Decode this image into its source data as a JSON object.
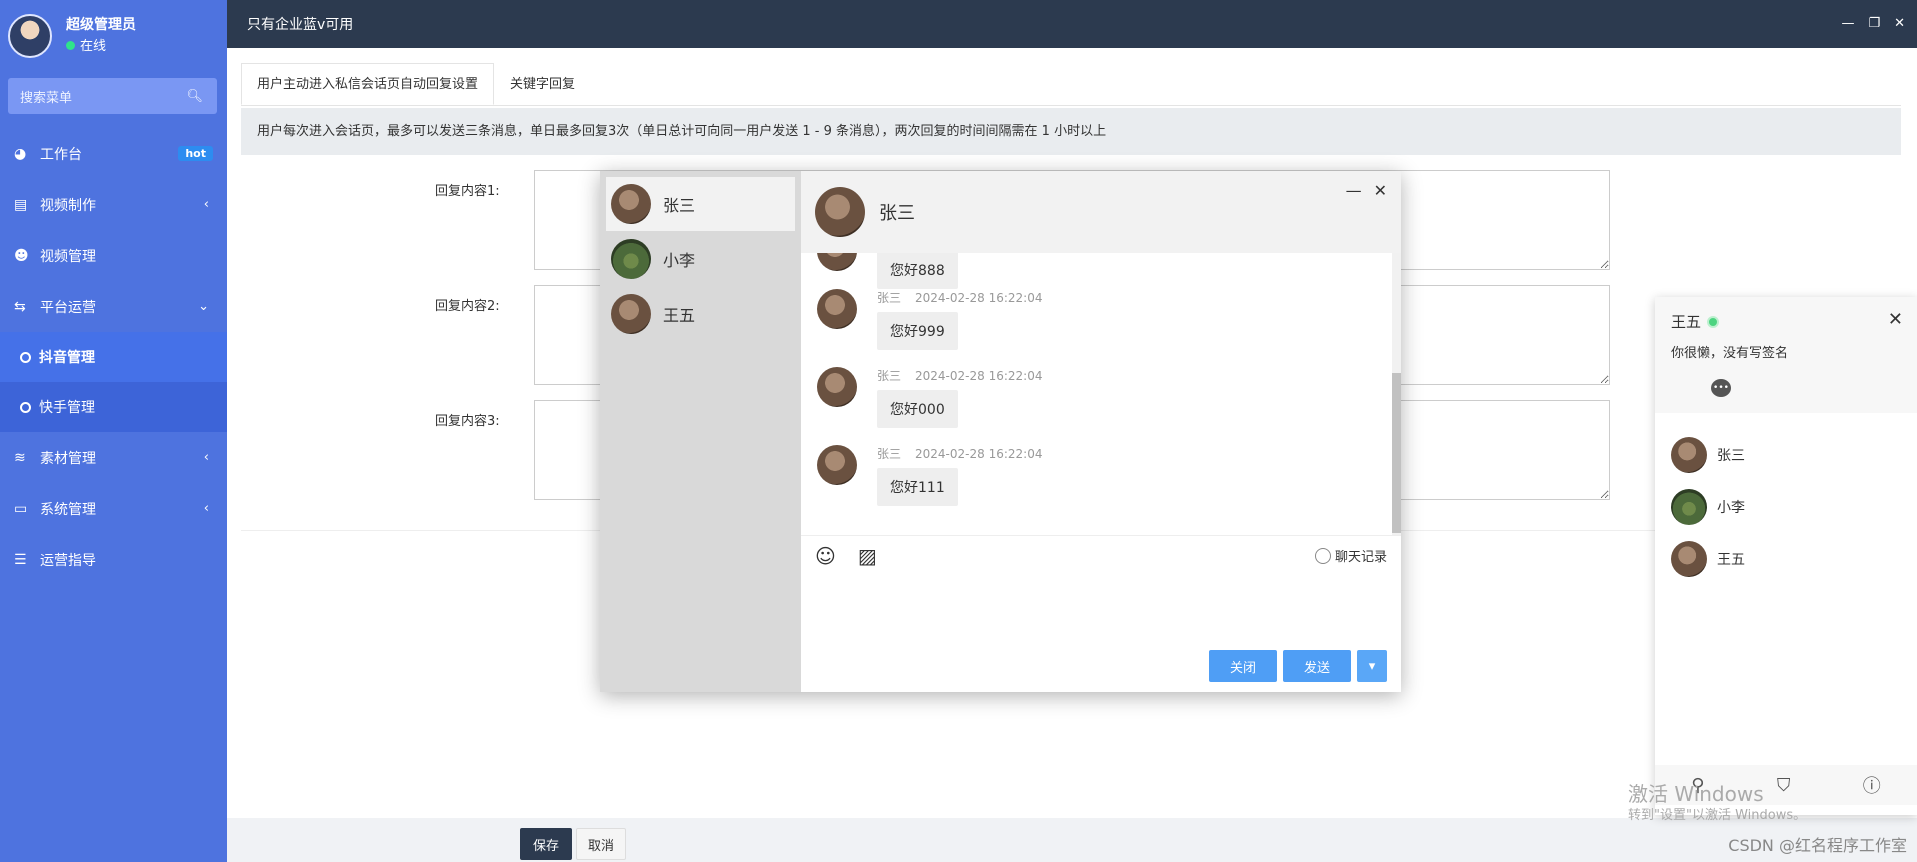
{
  "user": {
    "name": "超级管理员",
    "status": "在线"
  },
  "search": {
    "placeholder": "搜索菜单"
  },
  "menu": {
    "workbench": "工作台",
    "hot": "hot",
    "video_make": "视频制作",
    "video_manage": "视频管理",
    "platform": "平台运营",
    "douyin": "抖音管理",
    "kuaishou": "快手管理",
    "material": "素材管理",
    "system": "系统管理",
    "guide": "运营指导"
  },
  "window": {
    "title": "只有企业蓝v可用"
  },
  "tabs": [
    "用户主动进入私信会话页自动回复设置",
    "关键字回复"
  ],
  "notice": "用户每次进入会话页，最多可以发送三条消息，单日最多回复3次（单日总计可向同一用户发送 1 - 9 条消息），两次回复的时间间隔需在 1 小时以上",
  "form": {
    "label1": "回复内容1:",
    "label2": "回复内容2:",
    "label3": "回复内容3:"
  },
  "footer": {
    "save": "保存",
    "cancel": "取消"
  },
  "chat": {
    "list": [
      "张三",
      "小李",
      "王五"
    ],
    "header_name": "张三",
    "messages": [
      {
        "text": "您好888"
      },
      {
        "name": "张三",
        "time": "2024-02-28 16:22:04",
        "text": "您好999"
      },
      {
        "name": "张三",
        "time": "2024-02-28 16:22:04",
        "text": "您好000"
      },
      {
        "name": "张三",
        "time": "2024-02-28 16:22:04",
        "text": "您好111"
      }
    ],
    "history": "聊天记录",
    "close": "关闭",
    "send": "发送"
  },
  "contacts": {
    "name": "王五",
    "sign": "你很懒，没有写签名",
    "list": [
      "张三",
      "小李",
      "王五"
    ]
  },
  "watermark": {
    "line1": "激活 Windows",
    "line2": "转到\"设置\"以激活 Windows。"
  },
  "csdn": "CSDN @红名程序工作室"
}
